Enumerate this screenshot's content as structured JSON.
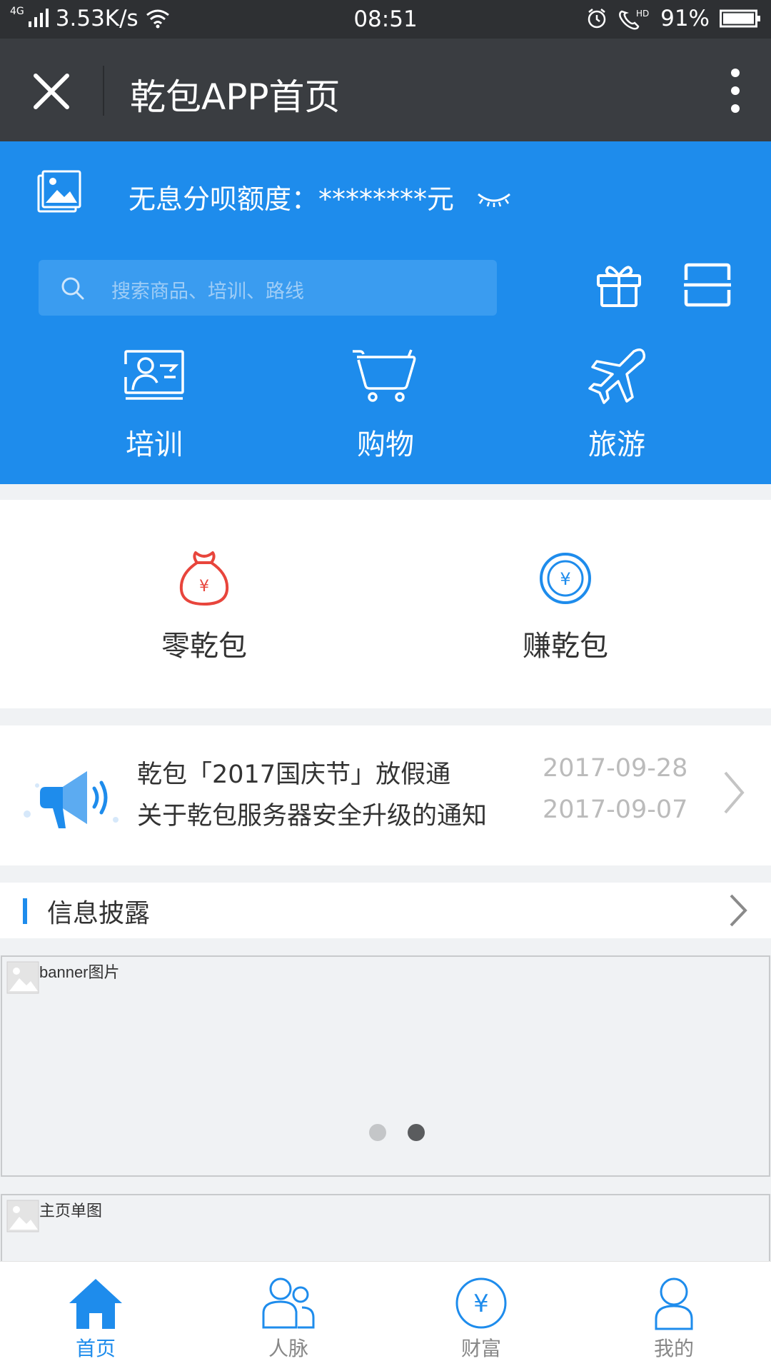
{
  "status_bar": {
    "network": "4G",
    "speed": "3.53K/s",
    "time": "08:51",
    "battery": "91%"
  },
  "title_bar": {
    "title": "乾包APP首页"
  },
  "header": {
    "quota_text": "无息分呗额度：********元",
    "search_placeholder": "搜索商品、培训、路线",
    "categories": [
      {
        "label": "培训",
        "icon": "training-icon"
      },
      {
        "label": "购物",
        "icon": "cart-icon"
      },
      {
        "label": "旅游",
        "icon": "plane-icon"
      }
    ]
  },
  "wallet": {
    "items": [
      {
        "label": "零乾包",
        "icon": "money-bag-icon"
      },
      {
        "label": "赚乾包",
        "icon": "coin-icon"
      }
    ]
  },
  "notices": {
    "items": [
      {
        "title": "乾包「2017国庆节」放假通",
        "date": "2017-09-28"
      },
      {
        "title": "关于乾包服务器安全升级的通知",
        "date": "2017-09-07"
      }
    ]
  },
  "info_section": {
    "title": "信息披露"
  },
  "banner": {
    "alt_text": "banner图片",
    "carousel": {
      "total": 2,
      "active": 2
    }
  },
  "single_image": {
    "alt_text": "主页单图"
  },
  "tab_bar": {
    "tabs": [
      {
        "label": "首页",
        "icon": "home-icon",
        "active": true
      },
      {
        "label": "人脉",
        "icon": "contacts-icon",
        "active": false
      },
      {
        "label": "财富",
        "icon": "wealth-icon",
        "active": false
      },
      {
        "label": "我的",
        "icon": "profile-icon",
        "active": false
      }
    ]
  },
  "colors": {
    "primary": "#1e8cec",
    "title_bar": "#3a3d41",
    "status_bar": "#2e3033",
    "accent_red": "#e8453c"
  }
}
